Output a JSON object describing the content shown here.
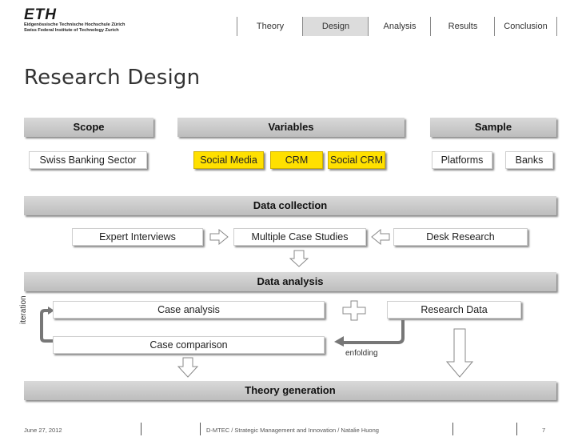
{
  "logo": {
    "mark": "ETH",
    "line1": "Eidgenössische Technische Hochschule Zürich",
    "line2": "Swiss Federal Institute of Technology Zurich"
  },
  "nav": {
    "tabs": [
      {
        "label": "Theory",
        "active": false
      },
      {
        "label": "Design",
        "active": true
      },
      {
        "label": "Analysis",
        "active": false
      },
      {
        "label": "Results",
        "active": false
      },
      {
        "label": "Conclusion",
        "active": false
      }
    ]
  },
  "page_title": "Research Design",
  "headers": {
    "scope": "Scope",
    "variables": "Variables",
    "sample": "Sample",
    "data_collection": "Data collection",
    "data_analysis": "Data analysis",
    "theory_generation": "Theory generation"
  },
  "scope_items": [
    "Swiss Banking Sector"
  ],
  "variables": [
    "Social Media",
    "CRM",
    "Social CRM"
  ],
  "sample_items": [
    "Platforms",
    "Banks"
  ],
  "collection": {
    "expert": "Expert Interviews",
    "case_studies": "Multiple Case Studies",
    "desk": "Desk Research"
  },
  "analysis": {
    "case_analysis": "Case analysis",
    "case_comparison": "Case comparison",
    "research_data": "Research Data",
    "iteration": "iteration",
    "enfolding": "enfolding"
  },
  "footer": {
    "date": "June 27, 2012",
    "center": "D-MTEC / Strategic Management and Innovation / Natalie Huong",
    "page": "7"
  },
  "colors": {
    "highlight": "#ffe000",
    "bar": "#c8c8c8"
  }
}
